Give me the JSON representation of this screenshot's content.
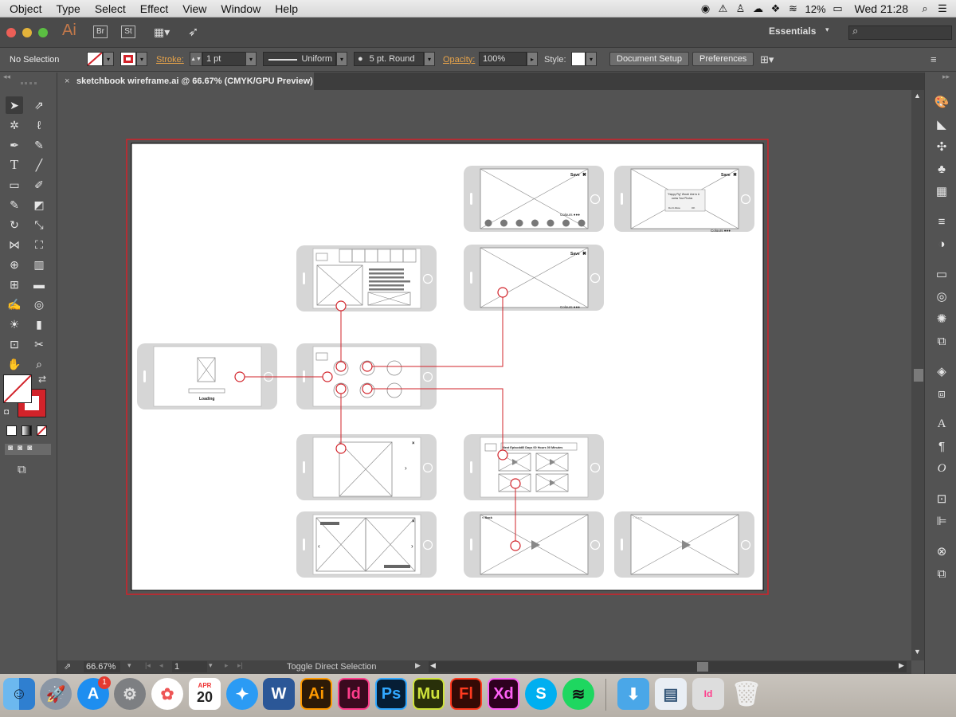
{
  "menubar": {
    "items": [
      "Object",
      "Type",
      "Select",
      "Effect",
      "View",
      "Window",
      "Help"
    ],
    "battery": "12%",
    "clock": "Wed 21:28"
  },
  "appbar": {
    "logo": "Ai",
    "br": "Br",
    "st": "St",
    "workspace": "Essentials"
  },
  "control": {
    "selection": "No Selection",
    "stroke_label": "Stroke:",
    "stroke_weight": "1 pt",
    "profile": "Uniform",
    "brush": "5 pt. Round",
    "opacity_label": "Opacity:",
    "opacity": "100%",
    "style_label": "Style:",
    "doc_setup": "Document Setup",
    "preferences": "Preferences"
  },
  "tab": {
    "title": "sketchbook wireframe.ai @ 66.67% (CMYK/GPU Preview)"
  },
  "status": {
    "zoom": "66.67%",
    "page": "1",
    "tool_hint": "Toggle Direct Selection"
  },
  "wireframe": {
    "save": "Save",
    "close": "✖",
    "colours": "Colours ●●●",
    "loading": "Loading",
    "dialog_text": "\"Happy Pig\" Would Like to Access Your Photos",
    "dialog_btn1": "Don't Allow",
    "dialog_btn2": "OK",
    "countdown": "Next Episode",
    "countdown_value": "30 Days 00 Hours 00 Minutes",
    "back": "< Back"
  },
  "dock": {
    "apps": [
      "Finder",
      "Launchpad",
      "App Store",
      "System Preferences",
      "Photos",
      "Calendar",
      "Safari",
      "Word",
      "Ai",
      "Id",
      "Ps",
      "Mu",
      "Fl",
      "Xd",
      "Skype",
      "Spotify",
      "Downloads",
      "Preview",
      "InDesign Doc",
      "Trash"
    ],
    "calendar_month": "APR",
    "calendar_day": "20",
    "badge": "1"
  },
  "colors": {
    "accent_red": "#d2232a",
    "ui_dark": "#535353"
  }
}
